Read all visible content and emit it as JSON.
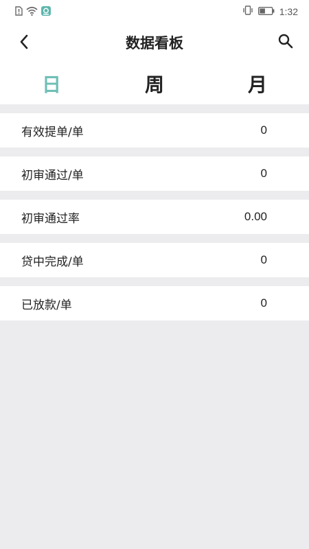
{
  "status_bar": {
    "time": "1:32",
    "left_icons": [
      "sim-alert-icon",
      "wifi-icon",
      "app-notification-icon"
    ],
    "right_icons": [
      "vibrate-icon",
      "battery-icon"
    ],
    "battery_level": 0.45
  },
  "header": {
    "title": "数据看板",
    "back_icon": "chevron-left-icon",
    "search_icon": "search-icon"
  },
  "tabs": [
    {
      "label": "日",
      "active": true
    },
    {
      "label": "周",
      "active": false
    },
    {
      "label": "月",
      "active": false
    }
  ],
  "stats": [
    {
      "label": "有效提单/单",
      "value": "0"
    },
    {
      "label": "初审通过/单",
      "value": "0"
    },
    {
      "label": "初审通过率",
      "value": "0.00"
    },
    {
      "label": "贷中完成/单",
      "value": "0"
    },
    {
      "label": "已放款/单",
      "value": "0"
    }
  ],
  "colors": {
    "accent": "#6fbfb6",
    "background": "#ececee",
    "card": "#ffffff",
    "text": "#222222"
  }
}
